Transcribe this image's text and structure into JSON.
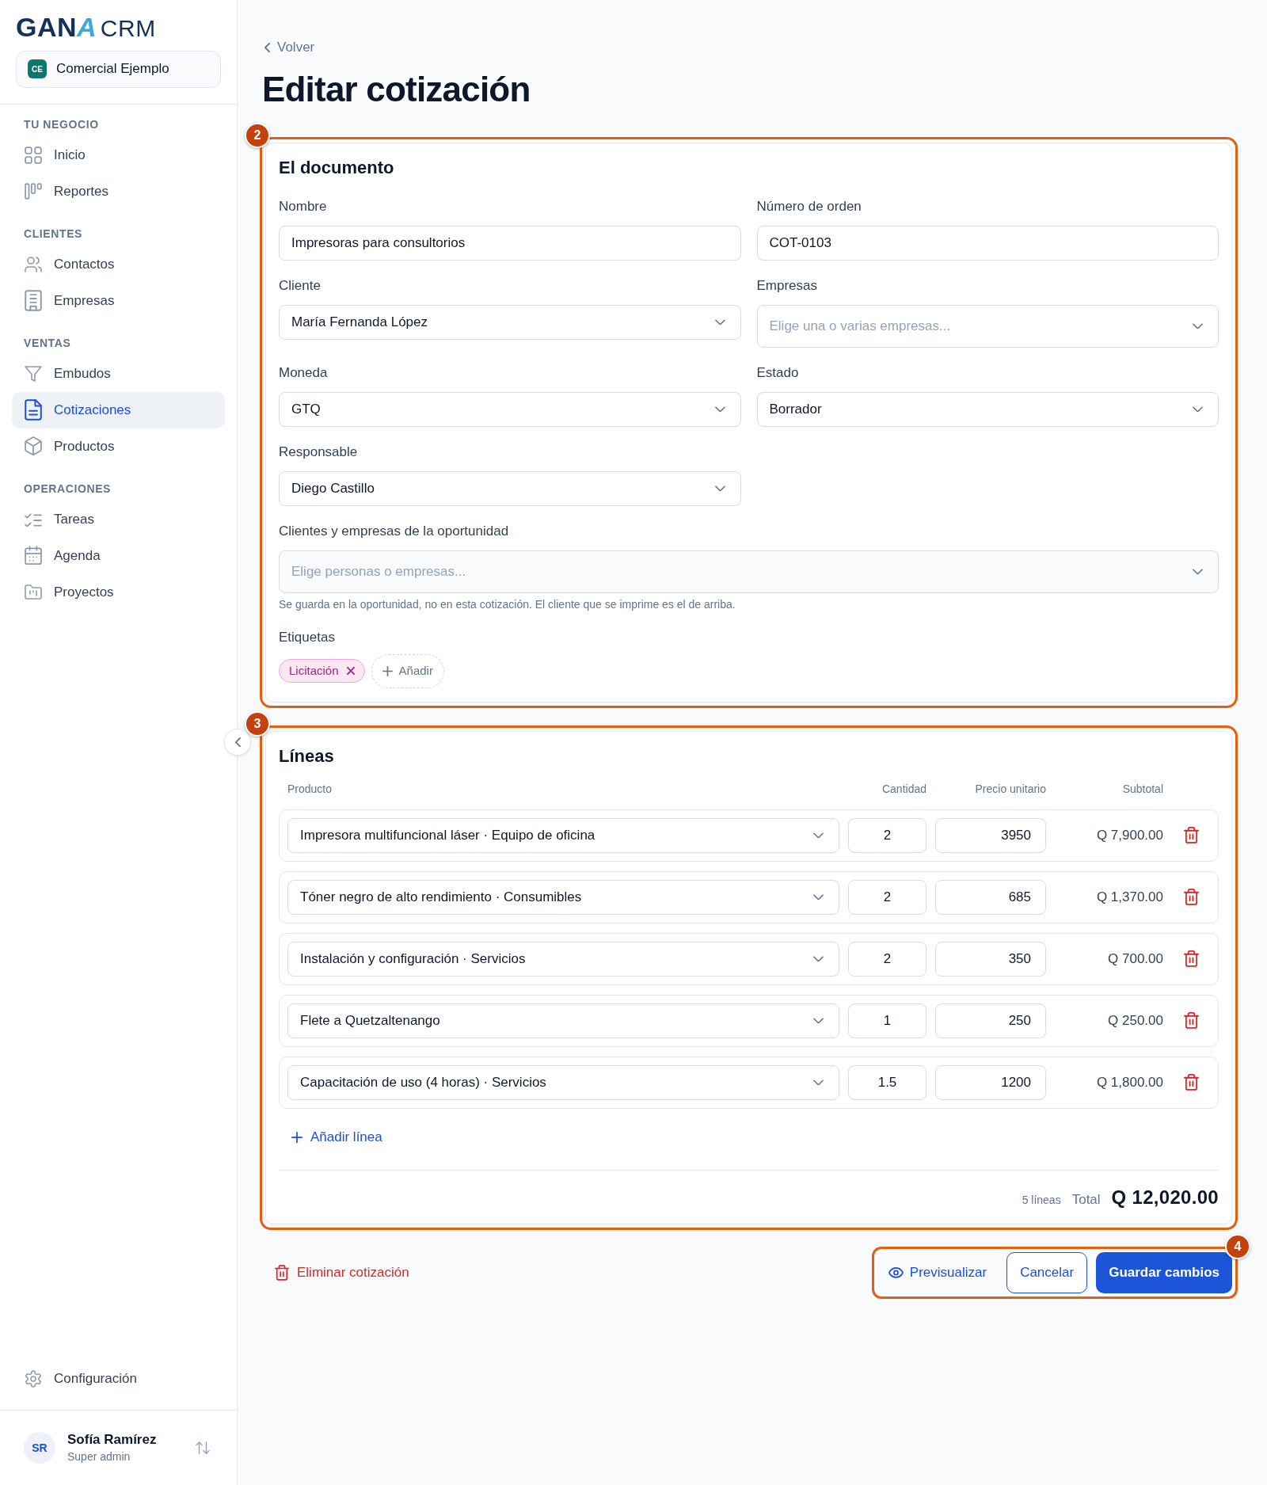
{
  "sidebar": {
    "logo": {
      "name": "GANA",
      "product": "CRM"
    },
    "workspace": {
      "initials": "CE",
      "name": "Comercial Ejemplo"
    },
    "sections": [
      {
        "title": "TU NEGOCIO",
        "items": [
          {
            "label": "Inicio",
            "selected": false
          },
          {
            "label": "Reportes",
            "selected": false
          }
        ]
      },
      {
        "title": "CLIENTES",
        "items": [
          {
            "label": "Contactos",
            "selected": false
          },
          {
            "label": "Empresas",
            "selected": false
          }
        ]
      },
      {
        "title": "VENTAS",
        "items": [
          {
            "label": "Embudos",
            "selected": false
          },
          {
            "label": "Cotizaciones",
            "selected": true
          },
          {
            "label": "Productos",
            "selected": false
          }
        ]
      },
      {
        "title": "OPERACIONES",
        "items": [
          {
            "label": "Tareas",
            "selected": false
          },
          {
            "label": "Agenda",
            "selected": false
          },
          {
            "label": "Proyectos",
            "selected": false
          }
        ]
      }
    ],
    "settings": {
      "label": "Configuración"
    },
    "user": {
      "initials": "SR",
      "name": "Sofía Ramírez",
      "role": "Super admin"
    }
  },
  "header": {
    "back_link": "Volver",
    "title": "Editar cotización"
  },
  "document": {
    "callout": "2",
    "title": "El documento",
    "fields": [
      {
        "kind": "text",
        "label": "Nombre",
        "value": "Impresoras para consultorios"
      },
      {
        "kind": "text",
        "label": "Número de orden",
        "value": "COT-0103"
      },
      {
        "kind": "select",
        "label": "Cliente",
        "value": "María Fernanda López"
      },
      {
        "kind": "multiselect",
        "label": "Empresas",
        "placeholder": "Elige una o varias empresas..."
      },
      {
        "kind": "select",
        "label": "Moneda",
        "value": "GTQ"
      },
      {
        "kind": "select",
        "label": "Estado",
        "value": "Borrador"
      },
      {
        "kind": "select",
        "label": "Responsable",
        "value": "Diego Castillo"
      },
      {
        "kind": "multiselect",
        "label": "Clientes y empresas de la oportunidad",
        "placeholder": "Elige personas o empresas...",
        "help": "Se guarda en la oportunidad, no en esta cotización. El cliente que se imprime es el de arriba.",
        "wide": true
      }
    ],
    "tags": {
      "label": "Etiquetas",
      "items": [
        {
          "label": "Licitación"
        }
      ],
      "add": "Añadir"
    }
  },
  "lines": {
    "callout": "3",
    "title": "Líneas",
    "columns": [
      "Producto",
      "Cantidad",
      "Precio unitario",
      "Subtotal"
    ],
    "rows": [
      {
        "product": "Impresora multifuncional láser · Equipo de oficina",
        "quantity": "2",
        "unit_price": "3950",
        "subtotal": "Q 7,900.00"
      },
      {
        "product": "Tóner negro de alto rendimiento · Consumibles",
        "quantity": "2",
        "unit_price": "685",
        "subtotal": "Q 1,370.00"
      },
      {
        "product": "Instalación y configuración · Servicios",
        "quantity": "2",
        "unit_price": "350",
        "subtotal": "Q 700.00"
      },
      {
        "product": "Flete a Quetzaltenango",
        "quantity": "1",
        "unit_price": "250",
        "subtotal": "Q 250.00"
      },
      {
        "product": "Capacitación de uso (4 horas) · Servicios",
        "quantity": "1.5",
        "unit_price": "1200",
        "subtotal": "Q 1,800.00"
      }
    ],
    "add_line": "Añadir línea",
    "line_count": "5 líneas",
    "total_label": "Total",
    "total": "Q 12,020.00"
  },
  "actions": {
    "delete": "Eliminar cotización",
    "callout": "4",
    "buttons": [
      {
        "kind": "link",
        "label": "Previsualizar"
      },
      {
        "kind": "outline",
        "label": "Cancelar"
      },
      {
        "kind": "primary",
        "label": "Guardar cambios"
      }
    ]
  }
}
